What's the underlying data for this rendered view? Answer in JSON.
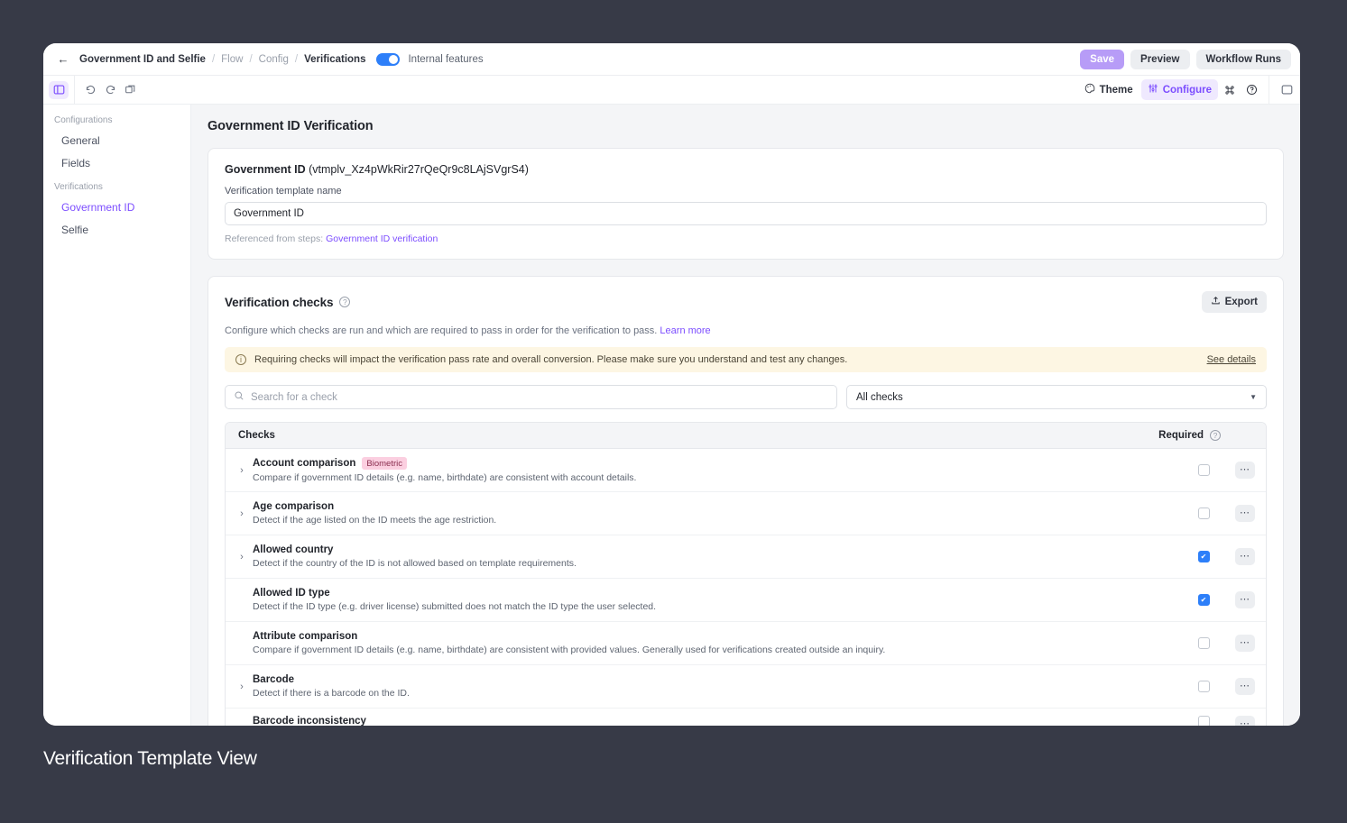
{
  "breadcrumb": {
    "back_icon": "arrow-left-icon",
    "items": [
      {
        "label": "Government ID and Selfie",
        "muted": false
      },
      {
        "label": "Flow",
        "muted": true
      },
      {
        "label": "Config",
        "muted": true
      },
      {
        "label": "Verifications",
        "muted": false
      }
    ],
    "separator": "/",
    "toggle_label": "Internal features",
    "toggle_on": true,
    "toggle_color": "#2d7ff9",
    "buttons": [
      {
        "label": "Save",
        "style": "primary",
        "color": "#b79cf7"
      },
      {
        "label": "Preview",
        "style": "ghost"
      },
      {
        "label": "Workflow Runs",
        "style": "ghost"
      }
    ]
  },
  "toolbar": {
    "panel_toggle_icon": "side-panel-icon",
    "undo_icon": "undo-icon",
    "redo_icon": "redo-icon",
    "duplicate_icon": "copy-frame-icon",
    "theme_label": "Theme",
    "theme_icon": "palette-icon",
    "configure_label": "Configure",
    "configure_icon": "sliders-icon",
    "command_icon": "command-icon",
    "help_icon": "question-circle-icon",
    "panel_right_icon": "right-panel-icon",
    "accent": "#7c4dff"
  },
  "sidebar": {
    "groups": [
      {
        "label": "Configurations",
        "items": [
          {
            "label": "General",
            "active": false
          },
          {
            "label": "Fields",
            "active": false
          }
        ]
      },
      {
        "label": "Verifications",
        "items": [
          {
            "label": "Government ID",
            "active": true
          },
          {
            "label": "Selfie",
            "active": false
          }
        ]
      }
    ]
  },
  "main": {
    "page_title": "Government ID Verification",
    "template_card": {
      "name": "Government ID",
      "id": "(vtmplv_Xz4pWkRir27rQeQr9c8LAjSVgrS4)",
      "field_label": "Verification template name",
      "field_value": "Government ID",
      "referenced_prefix": "Referenced from steps:",
      "referenced_link": "Government ID verification"
    },
    "checks": {
      "title": "Verification checks",
      "help_icon": "question-circle-icon",
      "export_label": "Export",
      "export_icon": "upload-icon",
      "description": "Configure which checks are run and which are required to pass in order for the verification to pass.",
      "description_link": "Learn more",
      "callout_icon": "info-icon",
      "callout_text": "Requiring checks will impact the verification pass rate and overall conversion. Please make sure you understand and test any changes.",
      "callout_link": "See details",
      "search_placeholder": "Search for a check",
      "search_icon": "search-icon",
      "search_value": "",
      "filter_value": "All checks",
      "filter_caret": "chevron-down-icon",
      "col_checks": "Checks",
      "col_required": "Required",
      "row_menu_label": "•••",
      "rows": [
        {
          "title": "Account comparison",
          "badge": "Biometric",
          "description": "Compare if government ID details (e.g. name, birthdate) are consistent with account details.",
          "expandable": true,
          "required": false
        },
        {
          "title": "Age comparison",
          "badge": "",
          "description": "Detect if the age listed on the ID meets the age restriction.",
          "expandable": true,
          "required": false
        },
        {
          "title": "Allowed country",
          "badge": "",
          "description": "Detect if the country of the ID is not allowed based on template requirements.",
          "expandable": true,
          "required": true
        },
        {
          "title": "Allowed ID type",
          "badge": "",
          "description": "Detect if the ID type (e.g. driver license) submitted does not match the ID type the user selected.",
          "expandable": false,
          "required": true
        },
        {
          "title": "Attribute comparison",
          "badge": "",
          "description": "Compare if government ID details (e.g. name, birthdate) are consistent with provided values. Generally used for verifications created outside an inquiry.",
          "expandable": false,
          "required": false
        },
        {
          "title": "Barcode",
          "badge": "",
          "description": "Detect if there is a barcode on the ID.",
          "expandable": true,
          "required": false
        }
      ],
      "clipped_row_title": "Barcode inconsistency"
    }
  },
  "caption": "Verification Template View"
}
